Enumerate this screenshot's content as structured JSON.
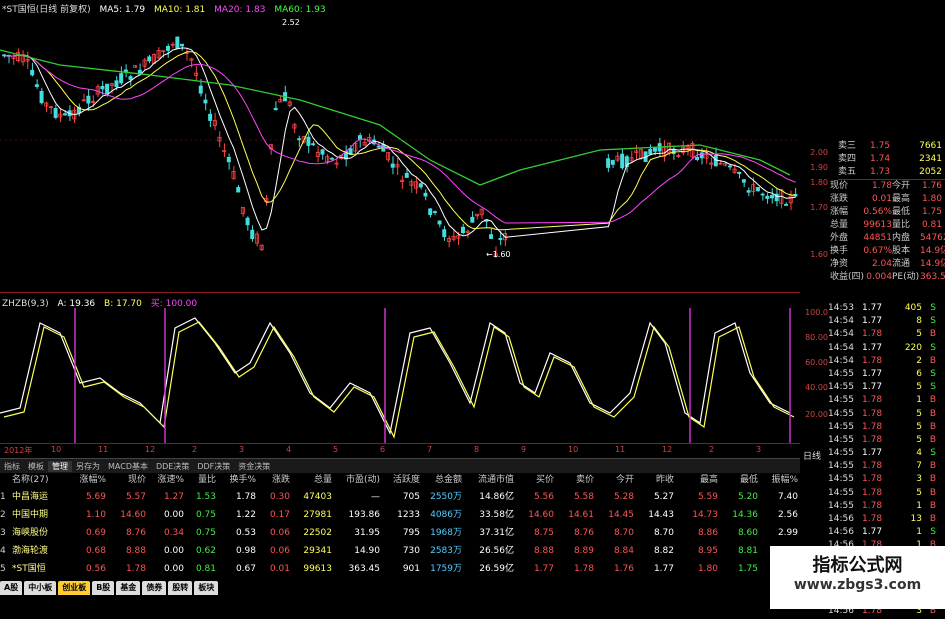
{
  "title": "*ST国恒(日线 前复权)",
  "ma_legend": [
    {
      "label": "MA5: 1.79",
      "color": "#ffffff"
    },
    {
      "label": "MA10: 1.81",
      "color": "#ffff55"
    },
    {
      "label": "MA20: 1.83",
      "color": "#ff44ff"
    },
    {
      "label": "MA60: 1.93",
      "color": "#44ff44"
    }
  ],
  "price_labels": {
    "high": "2.52",
    "low": "1.60"
  },
  "indicator_legend": [
    {
      "label": "ZHZB(9,3)",
      "color": "#dddddd"
    },
    {
      "label": "A: 19.36",
      "color": "#ffffff"
    },
    {
      "label": "B: 17.70",
      "color": "#ffff55"
    },
    {
      "label": "买: 100.00",
      "color": "#ff44ff"
    }
  ],
  "y_axis_right": [
    "2.00",
    "1.90",
    "1.80",
    "1.70",
    "1.60"
  ],
  "ind_axis": [
    "100.0",
    "80.00",
    "60.00",
    "40.00",
    "20.00"
  ],
  "date_axis": [
    "2012年",
    "10",
    "11",
    "12",
    "2",
    "3",
    "4",
    "5",
    "6",
    "7",
    "8",
    "9",
    "10",
    "11",
    "12",
    "2",
    "3"
  ],
  "quote": [
    {
      "l": "卖三",
      "v": "1.75",
      "n": "7661",
      "vc": "#ff5555"
    },
    {
      "l": "卖四",
      "v": "1.74",
      "n": "2341",
      "vc": "#ff5555"
    },
    {
      "l": "卖五",
      "v": "1.73",
      "n": "2052",
      "vc": "#ff5555"
    }
  ],
  "quote_detail": [
    [
      "现价",
      "1.78",
      "今开",
      "1.76"
    ],
    [
      "涨跌",
      "0.01",
      "最高",
      "1.80"
    ],
    [
      "涨幅",
      "0.56%",
      "最低",
      "1.75"
    ],
    [
      "总量",
      "99613",
      "量比",
      "0.81"
    ],
    [
      "外盘",
      "44851",
      "内盘",
      "54762"
    ],
    [
      "换手",
      "0.67%",
      "股本",
      "14.9亿"
    ],
    [
      "净资",
      "2.04",
      "流通",
      "14.9亿"
    ],
    [
      "收益(四)",
      "0.004",
      "PE(动)",
      "363.5"
    ]
  ],
  "ticks": [
    [
      "14:53",
      "1.77",
      "405",
      "S"
    ],
    [
      "14:54",
      "1.77",
      "8",
      "S"
    ],
    [
      "14:54",
      "1.78",
      "5",
      "B"
    ],
    [
      "14:54",
      "1.77",
      "220",
      "S"
    ],
    [
      "14:54",
      "1.78",
      "2",
      "B"
    ],
    [
      "14:55",
      "1.77",
      "6",
      "S"
    ],
    [
      "14:55",
      "1.77",
      "5",
      "S"
    ],
    [
      "14:55",
      "1.78",
      "1",
      "B"
    ],
    [
      "14:55",
      "1.78",
      "5",
      "B"
    ],
    [
      "14:55",
      "1.78",
      "5",
      "B"
    ],
    [
      "14:55",
      "1.78",
      "5",
      "B"
    ],
    [
      "14:55",
      "1.77",
      "4",
      "S"
    ],
    [
      "14:55",
      "1.78",
      "7",
      "B"
    ],
    [
      "14:55",
      "1.78",
      "3",
      "B"
    ],
    [
      "14:55",
      "1.78",
      "5",
      "B"
    ],
    [
      "14:55",
      "1.78",
      "1",
      "B"
    ],
    [
      "14:56",
      "1.78",
      "13",
      "B"
    ],
    [
      "14:56",
      "1.77",
      "1",
      "S"
    ],
    [
      "14:56",
      "1.78",
      "1",
      "B"
    ],
    [
      "14:56",
      "1.78",
      "39",
      "B"
    ],
    [
      "14:56",
      "1.78",
      "4",
      "B"
    ],
    [
      "14:56",
      "1.78",
      "4",
      "B"
    ],
    [
      "14:56",
      "1.77",
      "1",
      "S"
    ],
    [
      "14:56",
      "1.78",
      "3",
      "B"
    ]
  ],
  "side_label": "日线",
  "tabs": [
    "指标",
    "模板",
    "管理",
    "另存为",
    "MACD基本",
    "DDE决策",
    "DDF决策",
    "资金决策"
  ],
  "table_headers": [
    "名称(27)",
    "涨幅%",
    "现价",
    "涨速%",
    "量比",
    "换手%",
    "涨跌",
    "总量",
    "市盈(动)",
    "活跃度",
    "总金额",
    "流通市值",
    "买价",
    "卖价",
    "今开",
    "昨收",
    "最高",
    "最低",
    "振幅%"
  ],
  "table_rows": [
    [
      "1",
      "中昌海运",
      "5.69",
      "5.57",
      "1.27",
      "1.53",
      "1.78",
      "0.30",
      "47403",
      "—",
      "705",
      "2550万",
      "14.86亿",
      "5.56",
      "5.58",
      "5.28",
      "5.27",
      "5.59",
      "5.20",
      "7.40"
    ],
    [
      "2",
      "中国中期",
      "1.10",
      "14.60",
      "0.00",
      "0.75",
      "1.22",
      "0.17",
      "27981",
      "193.86",
      "1233",
      "4086万",
      "33.58亿",
      "14.60",
      "14.61",
      "14.45",
      "14.43",
      "14.73",
      "14.36",
      "2.56"
    ],
    [
      "3",
      "海峡股份",
      "0.69",
      "8.76",
      "0.34",
      "0.75",
      "0.53",
      "0.06",
      "22502",
      "31.95",
      "795",
      "1968万",
      "37.31亿",
      "8.75",
      "8.76",
      "8.70",
      "8.70",
      "8.86",
      "8.60",
      "2.99"
    ],
    [
      "4",
      "渤海轮渡",
      "0.68",
      "8.88",
      "0.00",
      "0.62",
      "0.98",
      "0.06",
      "29341",
      "14.90",
      "730",
      "2583万",
      "26.56亿",
      "8.88",
      "8.89",
      "8.84",
      "8.82",
      "8.95",
      "8.81",
      "1.58"
    ],
    [
      "5",
      "*ST国恒",
      "0.56",
      "1.78",
      "0.00",
      "0.81",
      "0.67",
      "0.01",
      "99613",
      "363.45",
      "901",
      "1759万",
      "26.59亿",
      "1.77",
      "1.78",
      "1.76",
      "1.77",
      "1.80",
      "1.75",
      "2.82"
    ]
  ],
  "bottom_tabs": [
    "A股",
    "中小板",
    "创业板",
    "B股",
    "基金",
    "债券",
    "股转",
    "板块"
  ],
  "watermark": {
    "title": "指标公式网",
    "url": "www.zbgs3.com"
  },
  "colors": {
    "up": "#ff5555",
    "down": "#44ee44",
    "flat": "#ffffff",
    "amount": "#55ccff",
    "ma60": "#33cc33"
  }
}
